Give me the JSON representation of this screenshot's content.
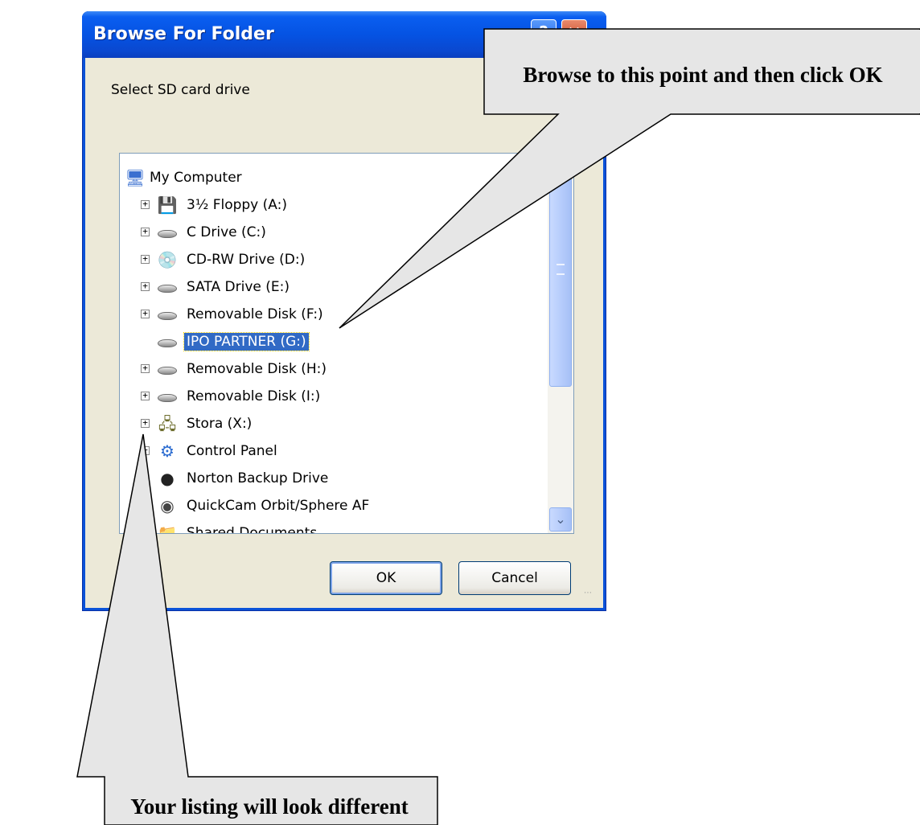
{
  "dialog": {
    "title": "Browse For Folder",
    "help_glyph": "?",
    "close_glyph": "✕",
    "prompt": "Select SD card drive"
  },
  "tree": {
    "items": [
      {
        "label": "My Computer",
        "icon": "my-computer-icon",
        "expander": false,
        "selected": false
      },
      {
        "label": "3½ Floppy (A:)",
        "icon": "floppy-drive-icon",
        "expander": true,
        "selected": false
      },
      {
        "label": "C Drive (C:)",
        "icon": "hard-drive-icon",
        "expander": true,
        "selected": false
      },
      {
        "label": "CD-RW Drive (D:)",
        "icon": "cd-drive-icon",
        "expander": true,
        "selected": false
      },
      {
        "label": "SATA Drive (E:)",
        "icon": "hard-drive-icon",
        "expander": true,
        "selected": false
      },
      {
        "label": "Removable Disk (F:)",
        "icon": "removable-disk-icon",
        "expander": true,
        "selected": false
      },
      {
        "label": "IPO PARTNER (G:)",
        "icon": "removable-disk-icon",
        "expander": false,
        "selected": true
      },
      {
        "label": "Removable Disk (H:)",
        "icon": "removable-disk-icon",
        "expander": true,
        "selected": false
      },
      {
        "label": "Removable Disk (I:)",
        "icon": "removable-disk-icon",
        "expander": true,
        "selected": false
      },
      {
        "label": "Stora (X:)",
        "icon": "network-drive-icon",
        "expander": true,
        "selected": false
      },
      {
        "label": "Control Panel",
        "icon": "control-panel-icon",
        "expander": true,
        "selected": false
      },
      {
        "label": "Norton Backup Drive",
        "icon": "norton-icon",
        "expander": false,
        "selected": false
      },
      {
        "label": "QuickCam Orbit/Sphere AF",
        "icon": "webcam-icon",
        "expander": false,
        "selected": false
      },
      {
        "label": "Shared Documents",
        "icon": "folder-icon",
        "expander": false,
        "selected": false
      }
    ]
  },
  "buttons": {
    "ok": "OK",
    "cancel": "Cancel"
  },
  "callouts": {
    "top": "Browse to this point and then click OK",
    "bottom": "Your listing will look different"
  },
  "colors": {
    "title_bar": "#0553e3",
    "dialog_face": "#ece9d8",
    "selection": "#316ac5",
    "callout_fill": "#e6e6e6"
  }
}
